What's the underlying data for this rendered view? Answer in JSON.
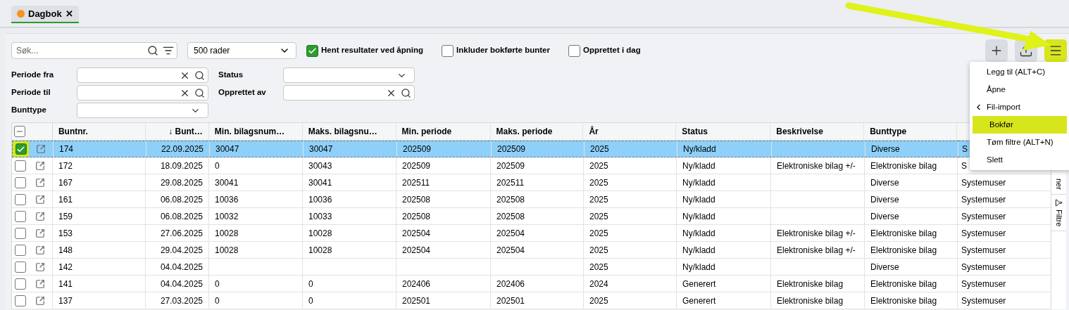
{
  "tabs": [
    {
      "label": "Dagbok",
      "selected": true,
      "color": "#f7931e",
      "close": "✕"
    }
  ],
  "search": {
    "placeholder": "Søk..."
  },
  "rows_select": {
    "value": "500 rader"
  },
  "options": [
    {
      "label": "Hent resultater ved åpning",
      "checked": true
    },
    {
      "label": "Inkluder bokførte bunter",
      "checked": false
    },
    {
      "label": "Opprettet i dag",
      "checked": false
    }
  ],
  "toolbar": [
    {
      "kind": "add",
      "highlighted": false
    },
    {
      "kind": "upload",
      "highlighted": false
    },
    {
      "kind": "menu",
      "highlighted": true
    }
  ],
  "menu": [
    {
      "label": "Legg til (ALT+C)",
      "kind": "item",
      "selected": false
    },
    {
      "label": "Åpne",
      "kind": "item",
      "selected": false
    },
    {
      "label": "Fil-import",
      "kind": "submenu",
      "selected": false
    },
    {
      "label": "Bokfør",
      "kind": "item",
      "selected": true
    },
    {
      "label": "Tøm filtre (ALT+N)",
      "kind": "item",
      "selected": false
    },
    {
      "label": "Slett",
      "kind": "item",
      "selected": false
    }
  ],
  "filters": [
    {
      "label": "Periode fra",
      "kind": "search"
    },
    {
      "label": "Status",
      "kind": "select"
    },
    {
      "label": "Periode til",
      "kind": "search"
    },
    {
      "label": "Opprettet av",
      "kind": "search"
    },
    {
      "label": "Bunttype",
      "kind": "select"
    }
  ],
  "table": {
    "columns": [
      "Buntnr.",
      "↓ Bunt…",
      "Min. bilagsnum…",
      "Maks. bilagsnu…",
      "Min. periode",
      "Maks. periode",
      "År",
      "Status",
      "Beskrivelse",
      "Bunttype"
    ],
    "select_all_indeterminate": true,
    "rows": [
      {
        "checked": true,
        "selected": true,
        "cells": [
          "174",
          "22.09.2025",
          "30047",
          "30047",
          "202509",
          "202509",
          "2025",
          "Ny/kladd",
          "",
          "Diverse",
          "S"
        ]
      },
      {
        "checked": false,
        "selected": false,
        "cells": [
          "172",
          "18.09.2025",
          "0",
          "30043",
          "202509",
          "202509",
          "2025",
          "Ny/kladd",
          "Elektroniske bilag +/-",
          "Elektroniske bilag",
          "S"
        ]
      },
      {
        "checked": false,
        "selected": false,
        "cells": [
          "167",
          "29.08.2025",
          "30041",
          "30041",
          "202511",
          "202511",
          "2025",
          "Ny/kladd",
          "",
          "Diverse",
          "Systemuser"
        ]
      },
      {
        "checked": false,
        "selected": false,
        "cells": [
          "161",
          "06.08.2025",
          "10036",
          "10036",
          "202508",
          "202508",
          "2025",
          "Ny/kladd",
          "",
          "Diverse",
          "Systemuser"
        ]
      },
      {
        "checked": false,
        "selected": false,
        "cells": [
          "159",
          "06.08.2025",
          "10032",
          "10033",
          "202508",
          "202508",
          "2025",
          "Ny/kladd",
          "",
          "Diverse",
          "Systemuser"
        ]
      },
      {
        "checked": false,
        "selected": false,
        "cells": [
          "153",
          "27.06.2025",
          "10028",
          "10028",
          "202504",
          "202504",
          "2025",
          "Ny/kladd",
          "Elektroniske bilag +/-",
          "Elektroniske bilag",
          "Systemuser"
        ]
      },
      {
        "checked": false,
        "selected": false,
        "cells": [
          "148",
          "29.04.2025",
          "10028",
          "10028",
          "202504",
          "202504",
          "2025",
          "Ny/kladd",
          "Elektroniske bilag +/-",
          "Elektroniske bilag",
          "Systemuser"
        ]
      },
      {
        "checked": false,
        "selected": false,
        "cells": [
          "142",
          "04.04.2025",
          "",
          "",
          "",
          "",
          "2025",
          "Ny/kladd",
          "",
          "Diverse",
          "Systemuser"
        ]
      },
      {
        "checked": false,
        "selected": false,
        "cells": [
          "141",
          "04.04.2025",
          "0",
          "0",
          "202406",
          "202406",
          "2024",
          "Generert",
          "Elektroniske bilag",
          "Elektroniske bilag",
          "Systemuser"
        ]
      },
      {
        "checked": false,
        "selected": false,
        "cells": [
          "137",
          "27.03.2025",
          "0",
          "0",
          "202501",
          "202501",
          "2025",
          "Generert",
          "Elektroniske bilag",
          "Elektroniske bilag",
          "Systemuser"
        ]
      }
    ]
  },
  "side_tabs": [
    {
      "label": "ner",
      "kind": "plain"
    },
    {
      "label": "Filtre",
      "kind": "filter"
    }
  ]
}
